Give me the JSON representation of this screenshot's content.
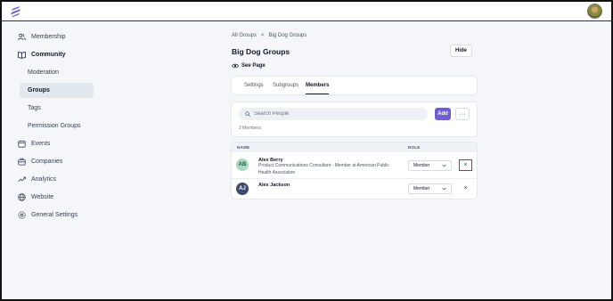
{
  "sidebar": {
    "membership": "Membership",
    "community": "Community",
    "moderation": "Moderation",
    "groups": "Groups",
    "tags": "Tags",
    "permission_groups": "Permission Groups",
    "events": "Events",
    "companies": "Companies",
    "analytics": "Analytics",
    "website": "Website",
    "general_settings": "General Settings"
  },
  "breadcrumb": {
    "parent": "All Groups",
    "separator": "<",
    "current": "Big Dog Groups"
  },
  "page": {
    "title": "Big Dog Groups",
    "hide_label": "Hide",
    "see_page_label": "See Page"
  },
  "tabs": [
    {
      "label": "Settings",
      "active": false
    },
    {
      "label": "Subgroups",
      "active": false
    },
    {
      "label": "Members",
      "active": true
    }
  ],
  "members": {
    "search_placeholder": "Search People",
    "add_label": "Add",
    "more_label": "···",
    "count_text": "2 Members"
  },
  "table": {
    "col_name": "NAME",
    "col_role": "ROLE",
    "rows": [
      {
        "initials": "AB",
        "name": "Alex Berry",
        "description": "Product Communications Consultant - Member at American Public Health Association",
        "role": "Member",
        "avatar_bg": "#a9d9bf",
        "avatar_fg": "#2f5f46"
      },
      {
        "initials": "AJ",
        "name": "Alex Jackson",
        "description": "",
        "role": "Member",
        "avatar_bg": "#3e4a6e",
        "avatar_fg": "#ffffff"
      }
    ]
  },
  "colors": {
    "accent": "#6d5dd6",
    "highlight": "#d11d4a",
    "header_line": "#2b2d6e"
  }
}
